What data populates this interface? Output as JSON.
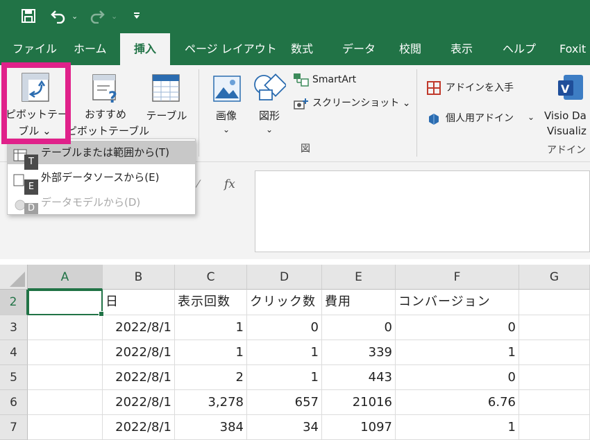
{
  "tabs": [
    "ファイル",
    "ホーム",
    "挿入",
    "ページ レイアウト",
    "数式",
    "データ",
    "校閲",
    "表示",
    "ヘルプ",
    "Foxit"
  ],
  "ribbon": {
    "pivot_line1": "ピボットテー",
    "pivot_line2": "ブル ⌄",
    "recommended_line1": "おすすめ",
    "recommended_line2": "ピボットテーブル",
    "table": "テーブル",
    "image": "画像",
    "image_caret": "⌄",
    "shapes": "図形",
    "shapes_caret": "⌄",
    "smartart": "SmartArt",
    "screenshot": "スクリーンショット ⌄",
    "illustrations_group": "図",
    "get_addins": "アドインを入手",
    "personal_addins": "個人用アドイン",
    "personal_caret": "⌄",
    "visio_line1": "Visio Da",
    "visio_line2": "Visualiz",
    "addins_group": "アドイン"
  },
  "dropdown": {
    "items": [
      {
        "label": "テーブルまたは範囲から(T)",
        "keytip": "T"
      },
      {
        "label": "外部データソースから(E)",
        "keytip": "E"
      },
      {
        "label": "データモデルから(D)",
        "keytip": "D"
      }
    ]
  },
  "formula": {
    "fx": "fx"
  },
  "grid": {
    "columns": [
      "A",
      "B",
      "C",
      "D",
      "E",
      "F",
      "G"
    ],
    "rows": [
      {
        "num": "2",
        "cells": [
          "",
          "日",
          "表示回数",
          "クリック数",
          "費用",
          "コンバージョン",
          ""
        ]
      },
      {
        "num": "3",
        "cells": [
          "",
          "2022/8/1",
          "1",
          "0",
          "0",
          "0",
          ""
        ]
      },
      {
        "num": "4",
        "cells": [
          "",
          "2022/8/1",
          "1",
          "1",
          "339",
          "1",
          ""
        ]
      },
      {
        "num": "5",
        "cells": [
          "",
          "2022/8/1",
          "2",
          "1",
          "443",
          "0",
          ""
        ]
      },
      {
        "num": "6",
        "cells": [
          "",
          "2022/8/1",
          "3,278",
          "657",
          "21016",
          "6.76",
          ""
        ]
      },
      {
        "num": "7",
        "cells": [
          "",
          "2022/8/1",
          "384",
          "34",
          "1097",
          "1",
          ""
        ]
      }
    ]
  },
  "colors": {
    "accent": "#217346",
    "highlight": "#e0218a"
  }
}
